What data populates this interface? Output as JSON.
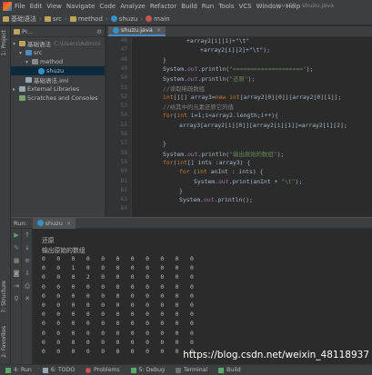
{
  "menu": {
    "items": [
      "File",
      "Edit",
      "View",
      "Navigate",
      "Code",
      "Analyze",
      "Refactor",
      "Build",
      "Run",
      "Tools",
      "VCS",
      "Window",
      "Help"
    ],
    "window_title": "JavaSE - shuzu.java"
  },
  "navbar": {
    "crumbs": [
      "基础语法",
      "src",
      "method",
      "shuzu",
      "main"
    ]
  },
  "left_strip": {
    "project_label": "1: Project",
    "structure_label": "7: Structure",
    "favorites_label": "2: Favorites"
  },
  "project": {
    "header": "Pr...",
    "items": [
      {
        "label": "基础语法",
        "path": "C:\\Users\\Admini"
      },
      {
        "label": "src"
      },
      {
        "label": "method"
      },
      {
        "label": "shuzu"
      },
      {
        "label": "基础语法.iml"
      },
      {
        "label": "External Libraries"
      },
      {
        "label": "Scratches and Consoles"
      }
    ]
  },
  "editor": {
    "tab_label": "shuzu.java",
    "line_numbers": [
      "46",
      "47",
      "48",
      "49",
      "50",
      "51",
      "52",
      "53",
      "54",
      "55",
      "56",
      "57",
      "58",
      "59",
      "60",
      "61",
      "62",
      "63",
      "64"
    ],
    "code": {
      "l0a": "+array2[i][1]+\"\\t\"",
      "l1a": "+array2[i][2]+\"\\t\");",
      "l2": "}",
      "l3a": "System.",
      "l3b": "out",
      "l3c": ".println(",
      "l3d": "\"====================\"",
      "l3e": ");",
      "l4a": "System.",
      "l4b": "out",
      "l4c": ".println(",
      "l4d": "\"还原\"",
      "l4e": ");",
      "l5": "//读取稀疏数组",
      "l6a": "int",
      "l6b": "[][] array3=",
      "l6c": "new int",
      "l6d": "[array2[0][0]][array2[0][1]];",
      "l7": "//给其中的元素还原它的值",
      "l8a": "for",
      "l8b": "(",
      "l8c": "int",
      "l8d": " i=1;i<array2.length;i++){",
      "l9": "array3[array2[i][0]][array2[i][1]]=array2[i][2];",
      "l10": "",
      "l11": "}",
      "l12a": "System.",
      "l12b": "out",
      "l12c": ".println(",
      "l12d": "\"输出原始的数组\"",
      "l12e": ");",
      "l13a": "for",
      "l13b": "(",
      "l13c": "int",
      "l13d": "[] ints :array3) {",
      "l14a": "for",
      "l14b": " (",
      "l14c": "int",
      "l14d": " anInt : ints) {",
      "l15a": "System.",
      "l15b": "out",
      "l15c": ".print(anInt + ",
      "l15d": "\"\\t\"",
      "l15e": ");",
      "l16": "}",
      "l17a": "System.",
      "l17b": "out",
      "l17c": ".println();"
    }
  },
  "run": {
    "header": "Run:",
    "tab_label": "shuzu",
    "output": {
      "line1": "还原",
      "line2": "输出原始的数组"
    },
    "matrix": [
      [
        "0",
        "0",
        "0",
        "0",
        "0",
        "0",
        "0",
        "0",
        "0",
        "0",
        "0"
      ],
      [
        "0",
        "0",
        "1",
        "0",
        "0",
        "0",
        "0",
        "0",
        "0",
        "0",
        "0"
      ],
      [
        "0",
        "0",
        "0",
        "2",
        "0",
        "0",
        "0",
        "0",
        "0",
        "0",
        "0"
      ],
      [
        "0",
        "0",
        "0",
        "0",
        "0",
        "0",
        "0",
        "0",
        "0",
        "0",
        "0"
      ],
      [
        "0",
        "0",
        "0",
        "0",
        "0",
        "0",
        "0",
        "0",
        "0",
        "0",
        "0"
      ],
      [
        "0",
        "0",
        "0",
        "0",
        "0",
        "0",
        "0",
        "0",
        "0",
        "0",
        "0"
      ],
      [
        "0",
        "0",
        "0",
        "0",
        "0",
        "0",
        "0",
        "0",
        "0",
        "0",
        "0"
      ],
      [
        "0",
        "0",
        "0",
        "0",
        "0",
        "0",
        "0",
        "0",
        "0",
        "0",
        "0"
      ],
      [
        "0",
        "0",
        "0",
        "0",
        "0",
        "0",
        "0",
        "0",
        "0",
        "0",
        "0"
      ],
      [
        "0",
        "0",
        "0",
        "0",
        "0",
        "0",
        "0",
        "0",
        "0",
        "0",
        "0"
      ],
      [
        "0",
        "0",
        "0",
        "0",
        "0",
        "0",
        "0",
        "0",
        "0",
        "0",
        "0"
      ]
    ]
  },
  "bottombar": {
    "run": "4: Run",
    "todo": "6: TODO",
    "problems": "Problems",
    "debug": "5: Debug",
    "terminal": "Terminal",
    "build": "Build"
  },
  "watermark": "https://blog.csdn.net/weixin_48118937",
  "colors": {
    "keyword": "#cc7832",
    "string": "#6a8759",
    "comment": "#808080",
    "field": "#9876aa",
    "background": "#2b2b2b",
    "panel": "#3c3f41"
  }
}
